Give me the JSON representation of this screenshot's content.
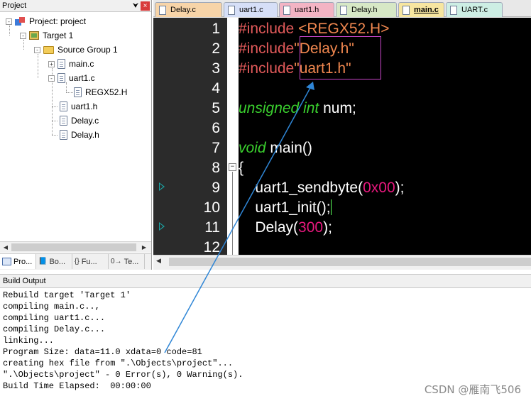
{
  "project_panel": {
    "title": "Project",
    "pin_glyph": "⮟",
    "close_glyph": "×",
    "tree": [
      {
        "label": "Project: project",
        "icon": "project-icon",
        "toggle": "-"
      },
      {
        "label": "Target 1",
        "icon": "target-icon",
        "toggle": "-"
      },
      {
        "label": "Source Group 1",
        "icon": "folder-icon",
        "toggle": "-"
      },
      {
        "label": "main.c",
        "icon": "file-icon",
        "toggle": "+"
      },
      {
        "label": "uart1.c",
        "icon": "file-icon",
        "toggle": "-"
      },
      {
        "label": "REGX52.H",
        "icon": "file-icon",
        "toggle": ""
      },
      {
        "label": "uart1.h",
        "icon": "file-icon",
        "toggle": ""
      },
      {
        "label": "Delay.c",
        "icon": "file-icon",
        "toggle": ""
      },
      {
        "label": "Delay.h",
        "icon": "file-icon",
        "toggle": ""
      }
    ],
    "bottom_tabs": [
      {
        "label": "Pro...",
        "icon": "project-tab-icon"
      },
      {
        "label": "Bo...",
        "icon": "books-tab-icon"
      },
      {
        "label": "Fu...",
        "icon": "functions-tab-icon",
        "glyph": "{}"
      },
      {
        "label": "Te...",
        "icon": "templates-tab-icon",
        "glyph": "0→"
      }
    ]
  },
  "editor": {
    "tabs": [
      {
        "label": "Delay.c",
        "color": "#f7d4a8"
      },
      {
        "label": "uart1.c",
        "color": "#d6dff7"
      },
      {
        "label": "uart1.h",
        "color": "#f3b4c4"
      },
      {
        "label": "Delay.h",
        "color": "#d7e8c6"
      },
      {
        "label": "main.c",
        "color": "#f7e6a0",
        "active": true
      },
      {
        "label": "UART.c",
        "color": "#cdeee4"
      }
    ],
    "line_numbers": [
      "1",
      "2",
      "3",
      "4",
      "5",
      "6",
      "7",
      "8",
      "9",
      "10",
      "11",
      "12"
    ],
    "code": {
      "l1_pre": "#include",
      "l1_arg": " <REGX52.H>",
      "l2_pre": "#include",
      "l2_arg": "\"Delay.h\"",
      "l3_pre": "#include",
      "l3_arg": "\"uart1.h\"",
      "l5_type": "unsigned int",
      "l5_rest": " num;",
      "l7_type": "void",
      "l7_rest": " main()",
      "l8": "{",
      "l9_fn": "    uart1_sendbyte(",
      "l9_num": "0x00",
      "l9_end": ");",
      "l10": "    uart1_init();",
      "l11_fn": "    Delay(",
      "l11_num": "300",
      "l11_end": ");"
    },
    "colors": {
      "preprocessor": "#e25a5a",
      "include_arg": "#f0874f",
      "type": "#3acf2e",
      "number": "#e8187e",
      "highlight_box": "#c846c8",
      "annotation_arrow": "#2f86d6"
    }
  },
  "build_output": {
    "title": "Build Output",
    "lines": [
      "Rebuild target 'Target 1'",
      "compiling main.c..,",
      "compiling uart1.c...",
      "compiling Delay.c...",
      "linking...",
      "Program Size: data=11.0 xdata=0 code=81",
      "creating hex file from \".\\Objects\\project\"...",
      "\".\\Objects\\project\" - 0 Error(s), 0 Warning(s).",
      "Build Time Elapsed:  00:00:00"
    ]
  },
  "watermark": "CSDN @雁南飞506"
}
